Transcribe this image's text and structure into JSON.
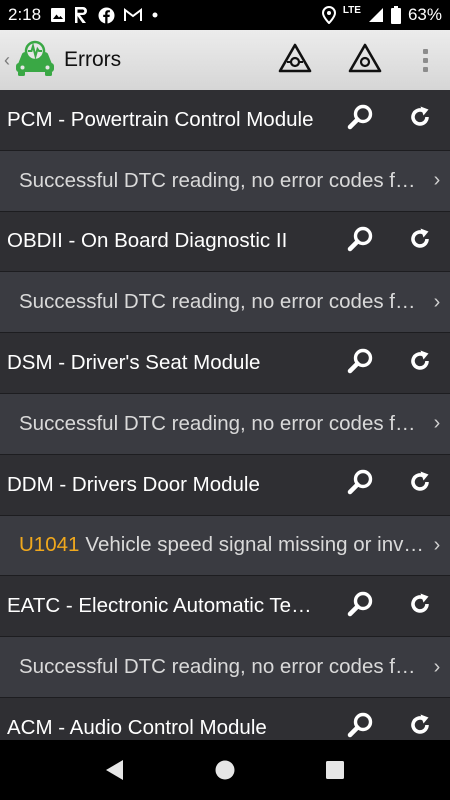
{
  "status_bar": {
    "time": "2:18",
    "network": "LTE",
    "battery": "63%",
    "icons": [
      "image-icon",
      "rakuten-icon",
      "facebook-icon",
      "gmail-icon",
      "dot-icon",
      "location-icon",
      "signal-icon",
      "battery-icon"
    ]
  },
  "action_bar": {
    "title": "Errors",
    "icons": [
      "back-chevron-icon",
      "car-diagnostic-logo",
      "warning-camera-icon",
      "warning-icon",
      "overflow-menu-icon"
    ]
  },
  "modules": [
    {
      "name": "PCM - Powertrain Control Module",
      "result": {
        "code": "",
        "text": "Successful DTC reading, no error codes found"
      }
    },
    {
      "name": "OBDII - On Board Diagnostic II",
      "result": {
        "code": "",
        "text": "Successful DTC reading, no error codes found"
      }
    },
    {
      "name": "DSM - Driver's Seat Module",
      "result": {
        "code": "",
        "text": "Successful DTC reading, no error codes found"
      }
    },
    {
      "name": "DDM - Drivers Door Module",
      "result": {
        "code": "U1041",
        "text": "Vehicle speed signal missing or invalid"
      }
    },
    {
      "name": "EATC - Electronic Automatic Temperature Control",
      "result": {
        "code": "",
        "text": "Successful DTC reading, no error codes found"
      }
    },
    {
      "name": "ACM - Audio Control Module",
      "result": null
    }
  ],
  "nav_bar": {
    "icons": [
      "back-triangle-icon",
      "home-circle-icon",
      "recents-square-icon"
    ]
  },
  "colors": {
    "accent_code": "#f0a81d",
    "module_bg": "#2f2f33",
    "result_bg": "#3a3b41",
    "logo_green": "#3aa845"
  }
}
